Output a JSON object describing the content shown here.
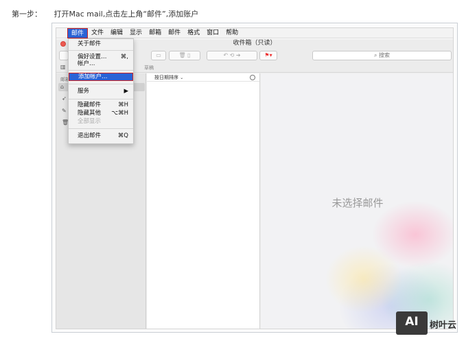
{
  "instruction": {
    "step_label": "第一步：",
    "text": "打开Mac mail,点击左上角“邮件”,添加账户"
  },
  "menubar": {
    "items": [
      "邮件",
      "文件",
      "编辑",
      "显示",
      "邮箱",
      "邮件",
      "格式",
      "窗口",
      "帮助"
    ]
  },
  "window": {
    "title": "收件箱（只读）",
    "search_placeholder": "搜索",
    "favorites_visible": [
      "草稿"
    ],
    "sidebar_section": "邮箱",
    "sort_label": "按日期排序",
    "empty_message": "未选择邮件"
  },
  "mail_menu": {
    "about": "关于邮件",
    "prefs": "偏好设置…",
    "prefs_shortcut": "⌘,",
    "accounts": "帐户…",
    "add_account": "添加帐户…",
    "services": "服务",
    "hide": "隐藏邮件",
    "hide_shortcut": "⌘H",
    "hide_others": "隐藏其他",
    "hide_others_shortcut": "⌥⌘H",
    "show_all": "全部显示",
    "quit": "退出邮件",
    "quit_shortcut": "⌘Q"
  },
  "watermark": {
    "logo_text": "AI",
    "brand": "树叶云"
  },
  "colors": {
    "accent": "#2a63d6",
    "highlight_border": "#cc2222"
  }
}
